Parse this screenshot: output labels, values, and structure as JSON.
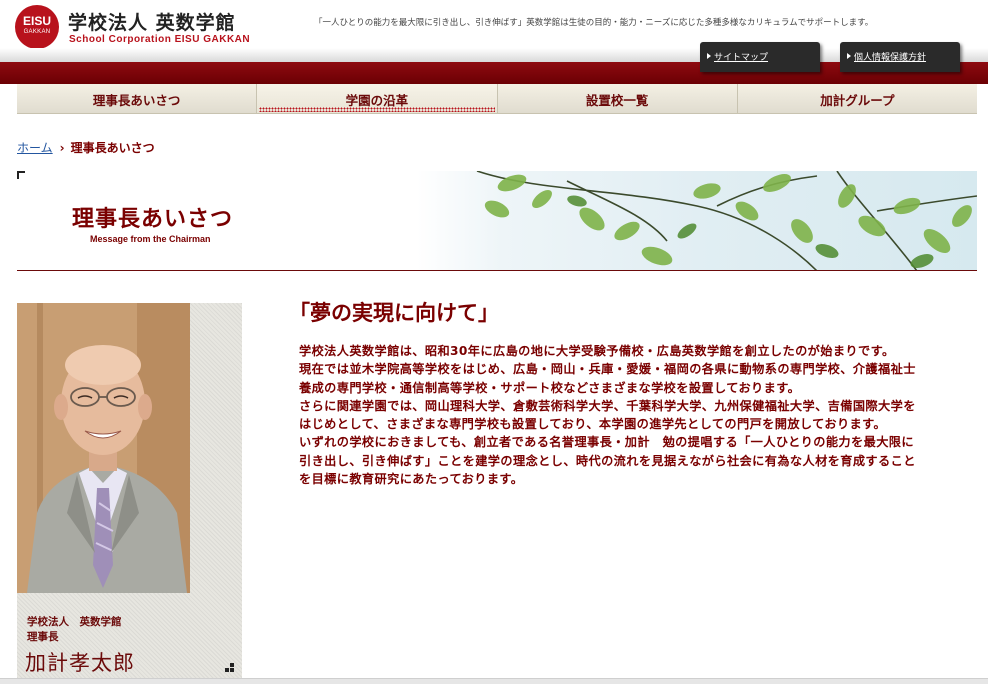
{
  "header": {
    "logo_top": "EISU",
    "logo_bottom": "GAKKAN",
    "org_name": "学校法人 英数学館",
    "org_name_en": "School Corporation EISU GAKKAN",
    "tagline": "「一人ひとりの能力を最大限に引き出し、引き伸ばす」英数学館は生徒の目的・能力・ニーズに応じた多種多様なカリキュラムでサポートします。",
    "utility_links": [
      {
        "label": "サイトマップ"
      },
      {
        "label": "個人情報保護方針"
      }
    ]
  },
  "nav": {
    "items": [
      {
        "label": "理事長あいさつ"
      },
      {
        "label": "学園の沿革"
      },
      {
        "label": "設置校一覧"
      },
      {
        "label": "加計グループ"
      }
    ],
    "active_index": 1
  },
  "breadcrumb": {
    "home": "ホーム",
    "separator": "›",
    "current": "理事長あいさつ"
  },
  "banner": {
    "title": "理事長あいさつ",
    "subtitle": "Message from the Chairman"
  },
  "portrait": {
    "org": "学校法人　英数学館",
    "role": "理事長",
    "name": "加計孝太郎"
  },
  "message": {
    "heading": "「夢の実現に向けて」",
    "paragraphs": [
      "学校法人英数学館は、昭和30年に広島の地に大学受験予備校・広島英数学館を創立したのが始まりです。",
      "現在では並木学院高等学校をはじめ、広島・岡山・兵庫・愛媛・福岡の各県に動物系の専門学校、介護福祉士養成の専門学校・通信制高等学校・サポート校などさまざまな学校を設置しております。",
      "さらに関連学園では、岡山理科大学、倉敷芸術科学大学、千葉科学大学、九州保健福祉大学、吉備国際大学をはじめとして、さまざまな専門学校も設置しており、本学園の進学先としての門戸を開放しております。",
      "いずれの学校におきましても、創立者である名誉理事長・加計　勉の提唱する「一人ひとりの能力を最大限に引き出し、引き伸ばす」ことを建学の理念とし、時代の流れを見据えながら社会に有為な人材を育成することを目標に教育研究にあたっております。"
    ]
  },
  "colors": {
    "brand_red": "#b8121c",
    "text_maroon": "#7a0000",
    "link_blue": "#2356a0"
  }
}
